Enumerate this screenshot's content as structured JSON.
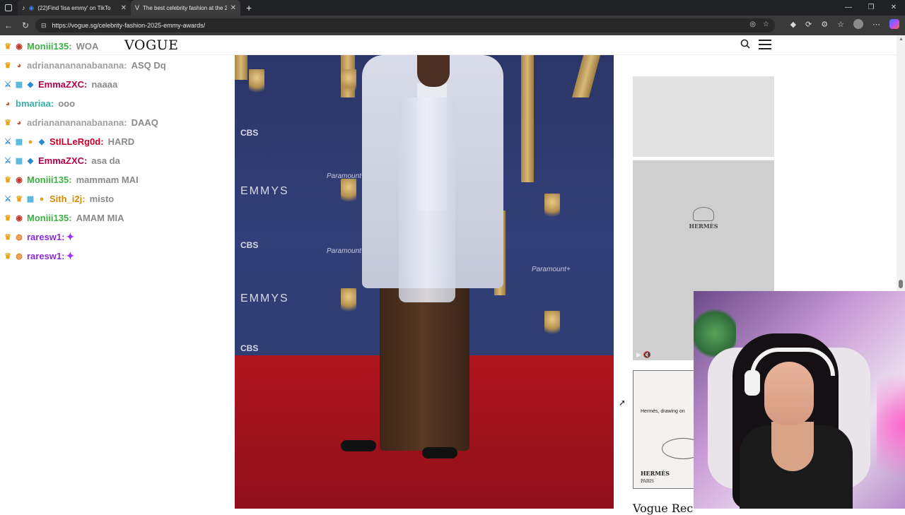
{
  "browser": {
    "tabs": [
      {
        "title": "(22)Find 'lisa emmy' on TikTo",
        "active": false
      },
      {
        "title": "The best celebrity fashion at the 2",
        "active": true
      }
    ],
    "url": "https://vogue.sg/celebrity-fashion-2025-emmy-awards/"
  },
  "page": {
    "logo": "VOGUE",
    "ad_text": "Hermès, drawing on",
    "ad_brand": "HERMÈS",
    "ad_brand_sub": "PARIS",
    "bottom_heading": "Vogue Rec"
  },
  "photo": {
    "sponsor_logo": "CBS",
    "sponsor_logo_2": "Paramount+",
    "event_logo": "EMMYS"
  },
  "chat": {
    "messages": [
      {
        "badges": [
          "crown",
          "pig"
        ],
        "user": "Moniii135:",
        "color": "#3cb043",
        "text": "WOA"
      },
      {
        "badges": [
          "crown",
          "cat"
        ],
        "user": "adriananananabanana:",
        "color": "#a0a0a0",
        "text": "ASQ Dq"
      },
      {
        "badges": [
          "sword",
          "gift",
          "cube"
        ],
        "user": "EmmaZXC:",
        "color": "#b0004b",
        "text": "naaaa"
      },
      {
        "badges": [
          "cat"
        ],
        "user": "bmariaa:",
        "color": "#36b1a8",
        "text": "ooo"
      },
      {
        "badges": [
          "crown",
          "cat"
        ],
        "user": "adriananananabanana:",
        "color": "#a0a0a0",
        "text": "DAAQ"
      },
      {
        "badges": [
          "sword",
          "gift",
          "coin",
          "cube"
        ],
        "user": "StILLeRg0d:",
        "color": "#c8002b",
        "text": "HARD"
      },
      {
        "badges": [
          "sword",
          "gift",
          "cube"
        ],
        "user": "EmmaZXC:",
        "color": "#b0004b",
        "text": "asa da"
      },
      {
        "badges": [
          "crown",
          "pig"
        ],
        "user": "Moniii135:",
        "color": "#3cb043",
        "text": "mammam MAI"
      },
      {
        "badges": [
          "sword",
          "crown",
          "gift",
          "coin"
        ],
        "user": "Sith_i2j:",
        "color": "#d48a0a",
        "text": "misto"
      },
      {
        "badges": [
          "crown",
          "pig"
        ],
        "user": "Moniii135:",
        "color": "#3cb043",
        "text": "AMAM MIA"
      },
      {
        "badges": [
          "crown",
          "bee"
        ],
        "user": "raresw1:",
        "color": "#8a2be2",
        "text": "",
        "emote": "purple-emote"
      },
      {
        "badges": [
          "crown",
          "bee"
        ],
        "user": "raresw1:",
        "color": "#8a2be2",
        "text": "",
        "emote": "purple-emote"
      }
    ]
  }
}
